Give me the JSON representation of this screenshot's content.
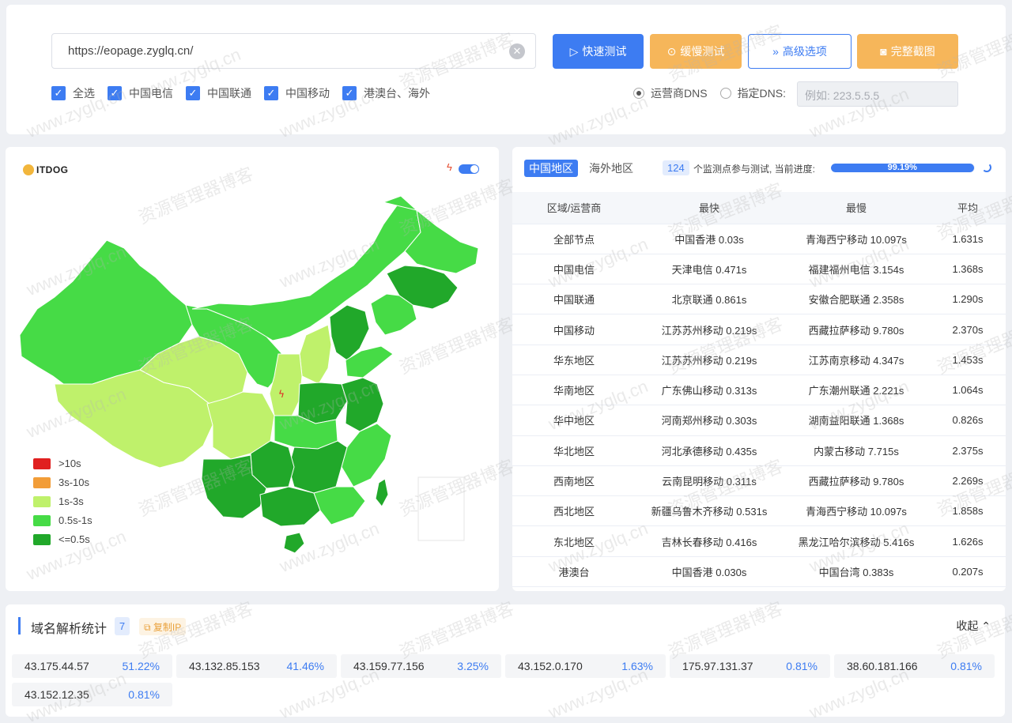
{
  "toolbar": {
    "url": "https://eopage.zyglq.cn/",
    "quick_test": "快速测试",
    "slow_test": "缓慢测试",
    "advanced": "高级选项",
    "screenshot": "完整截图"
  },
  "filters": {
    "checkboxes": [
      "全选",
      "中国电信",
      "中国联通",
      "中国移动",
      "港澳台、海外"
    ],
    "dns_isp": "运营商DNS",
    "dns_custom": "指定DNS:",
    "dns_placeholder": "例如: 223.5.5.5"
  },
  "map": {
    "logo": "ITDOG",
    "legend": [
      {
        "label": ">10s",
        "color": "#e02020"
      },
      {
        "label": "3s-10s",
        "color": "#f29d38"
      },
      {
        "label": "1s-3s",
        "color": "#bff16b"
      },
      {
        "label": "0.5s-1s",
        "color": "#46db46"
      },
      {
        "label": "<=0.5s",
        "color": "#21a82a"
      }
    ]
  },
  "stats": {
    "tab_china": "中国地区",
    "tab_overseas": "海外地区",
    "node_count": "124",
    "count_text": "个监测点参与测试, 当前进度:",
    "progress_label": "99.19%",
    "progress": 99.19,
    "columns": [
      "区域/运营商",
      "最快",
      "最慢",
      "平均"
    ],
    "rows": [
      [
        "全部节点",
        "中国香港 0.03s",
        "青海西宁移动 10.097s",
        "1.631s"
      ],
      [
        "中国电信",
        "天津电信 0.471s",
        "福建福州电信 3.154s",
        "1.368s"
      ],
      [
        "中国联通",
        "北京联通 0.861s",
        "安徽合肥联通 2.358s",
        "1.290s"
      ],
      [
        "中国移动",
        "江苏苏州移动 0.219s",
        "西藏拉萨移动 9.780s",
        "2.370s"
      ],
      [
        "华东地区",
        "江苏苏州移动 0.219s",
        "江苏南京移动 4.347s",
        "1.453s"
      ],
      [
        "华南地区",
        "广东佛山移动 0.313s",
        "广东潮州联通 2.221s",
        "1.064s"
      ],
      [
        "华中地区",
        "河南郑州移动 0.303s",
        "湖南益阳联通 1.368s",
        "0.826s"
      ],
      [
        "华北地区",
        "河北承德移动 0.435s",
        "内蒙古移动 7.715s",
        "2.375s"
      ],
      [
        "西南地区",
        "云南昆明移动 0.311s",
        "西藏拉萨移动 9.780s",
        "2.269s"
      ],
      [
        "西北地区",
        "新疆乌鲁木齐移动 0.531s",
        "青海西宁移动 10.097s",
        "1.858s"
      ],
      [
        "东北地区",
        "吉林长春移动 0.416s",
        "黑龙江哈尔滨移动 5.416s",
        "1.626s"
      ],
      [
        "港澳台",
        "中国香港 0.030s",
        "中国台湾 0.383s",
        "0.207s"
      ]
    ]
  },
  "dns_stats": {
    "title": "域名解析统计",
    "count": "7",
    "copy_ip": "复制IP",
    "collapse": "收起",
    "ips": [
      {
        "ip": "43.175.44.57",
        "pct": "51.22%"
      },
      {
        "ip": "43.132.85.153",
        "pct": "41.46%"
      },
      {
        "ip": "43.159.77.156",
        "pct": "3.25%"
      },
      {
        "ip": "43.152.0.170",
        "pct": "1.63%"
      },
      {
        "ip": "175.97.131.37",
        "pct": "0.81%"
      },
      {
        "ip": "38.60.181.166",
        "pct": "0.81%"
      },
      {
        "ip": "43.152.12.35",
        "pct": "0.81%"
      }
    ]
  },
  "watermark": [
    "资源管理器博客",
    "www.zyglq.cn"
  ]
}
